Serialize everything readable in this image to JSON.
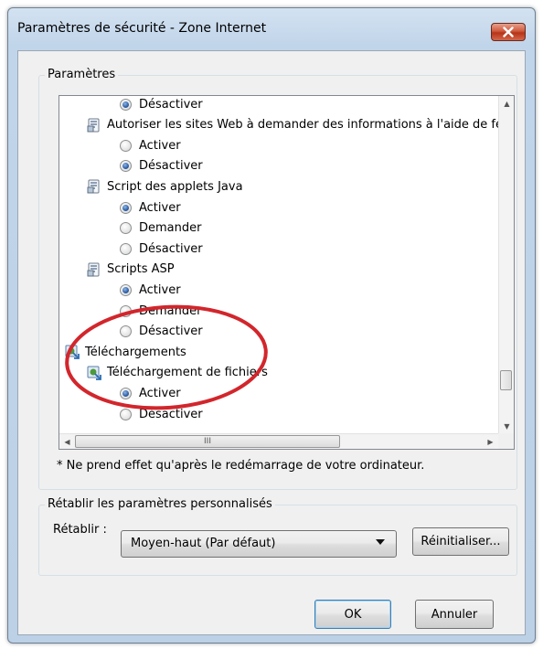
{
  "window": {
    "title": "Paramètres de sécurité - Zone Internet"
  },
  "settings_group": {
    "legend": "Paramètres"
  },
  "tree": {
    "rows": [
      {
        "kind": "radio",
        "label": "Désactiver",
        "checked": true
      },
      {
        "kind": "item",
        "label": "Autoriser les sites Web à demander des informations à l'aide de fenêtre"
      },
      {
        "kind": "radio",
        "label": "Activer",
        "checked": false
      },
      {
        "kind": "radio",
        "label": "Désactiver",
        "checked": true
      },
      {
        "kind": "item",
        "label": "Script des applets Java"
      },
      {
        "kind": "radio",
        "label": "Activer",
        "checked": true
      },
      {
        "kind": "radio",
        "label": "Demander",
        "checked": false
      },
      {
        "kind": "radio",
        "label": "Désactiver",
        "checked": false
      },
      {
        "kind": "item",
        "label": "Scripts ASP"
      },
      {
        "kind": "radio",
        "label": "Activer",
        "checked": true
      },
      {
        "kind": "radio",
        "label": "Demander",
        "checked": false
      },
      {
        "kind": "radio",
        "label": "Désactiver",
        "checked": false
      },
      {
        "kind": "category",
        "label": "Téléchargements"
      },
      {
        "kind": "subcategory",
        "label": "Téléchargement de fichiers"
      },
      {
        "kind": "radio",
        "label": "Activer",
        "checked": true
      },
      {
        "kind": "radio",
        "label": "Désactiver",
        "checked": false
      }
    ],
    "hscroll_grip": "III"
  },
  "note": "* Ne prend effet qu'après le redémarrage de votre ordinateur.",
  "reset_group": {
    "legend": "Rétablir les paramètres personnalisés",
    "reset_label": "Rétablir :",
    "level_value": "Moyen-haut (Par défaut)",
    "reset_button": "Réinitialiser..."
  },
  "buttons": {
    "ok": "OK",
    "cancel": "Annuler"
  },
  "colors": {
    "highlight_circle": "#d2262c",
    "radio_selected": "#2d5fa6"
  }
}
